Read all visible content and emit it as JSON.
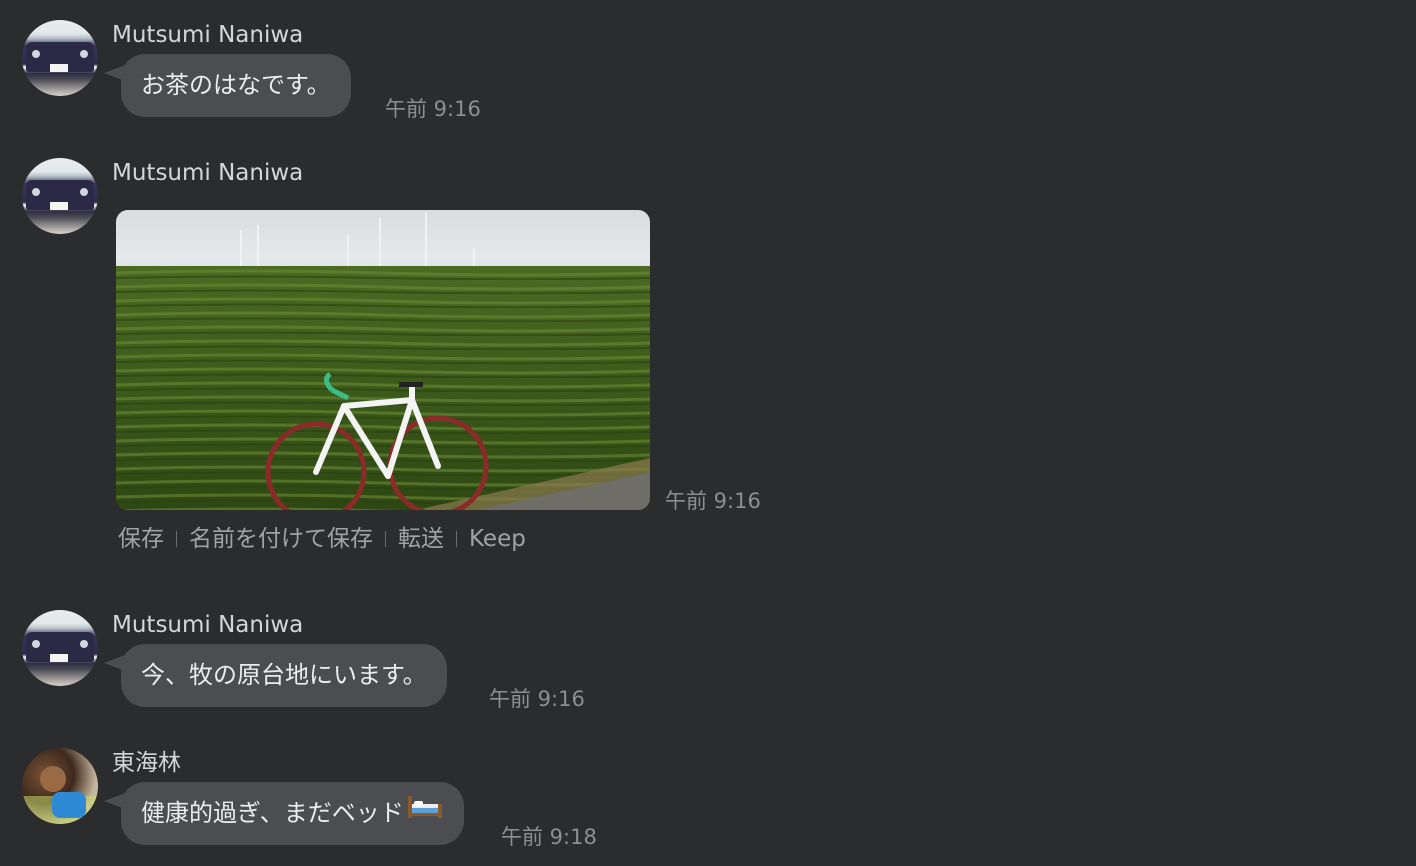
{
  "messages": [
    {
      "sender": "Mutsumi Naniwa",
      "text": "お茶のはなです。",
      "time": "午前 9:16"
    },
    {
      "sender": "Mutsumi Naniwa",
      "image": "tea-field-bicycle-photo",
      "time": "午前 9:16",
      "actions": [
        "保存",
        "名前を付けて保存",
        "転送",
        "Keep"
      ]
    },
    {
      "sender": "Mutsumi Naniwa",
      "text": "今、牧の原台地にいます。",
      "time": "午前 9:16"
    },
    {
      "sender": "東海林",
      "text": "健康的過ぎ、まだベッド",
      "emoji": "bed-emoji",
      "time": "午前 9:18"
    }
  ],
  "colors": {
    "background": "#2b2c2e",
    "bubble": "#4c4d50",
    "sender_text": "#d5d6d8",
    "time_text": "#8d8e92",
    "action_text": "#a1a2a6"
  }
}
